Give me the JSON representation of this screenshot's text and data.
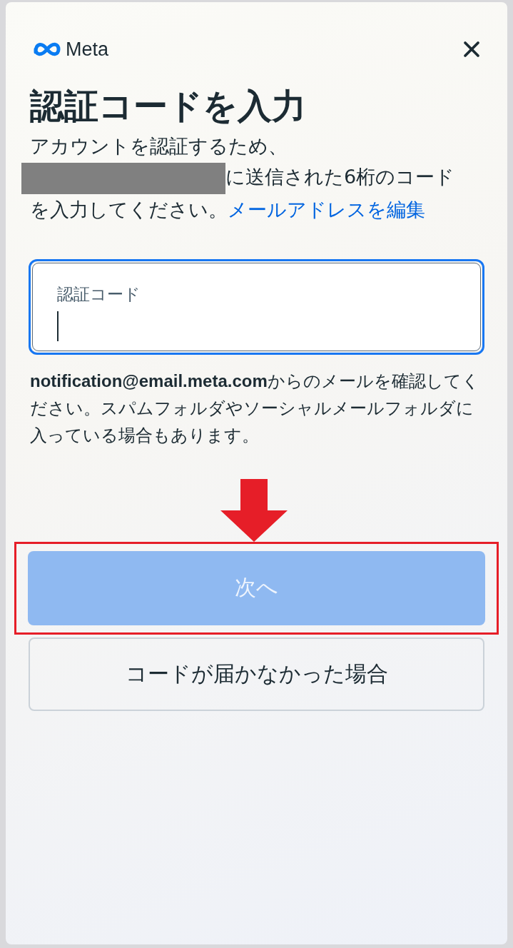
{
  "header": {
    "brand": "Meta"
  },
  "title": "認証コードを入力",
  "description": {
    "lead": "アカウントを認証するため、",
    "redacted": true,
    "rest": "に送信された6桁のコードを入力してください。",
    "link": "メールアドレスを編集"
  },
  "code_field": {
    "label": "認証コード",
    "focused": true
  },
  "help_text": "**notification@email.meta.com**からのメールを確認してください。スパムフォルダやソーシャルメールフォルダに入っている場合もあります。",
  "buttons": [
    {
      "label": "次へ",
      "kind": "primary",
      "disabled": true,
      "highlighted": true
    },
    {
      "label": "コードが届かなかった場合",
      "kind": "secondary",
      "disabled": false,
      "highlighted": false
    }
  ]
}
